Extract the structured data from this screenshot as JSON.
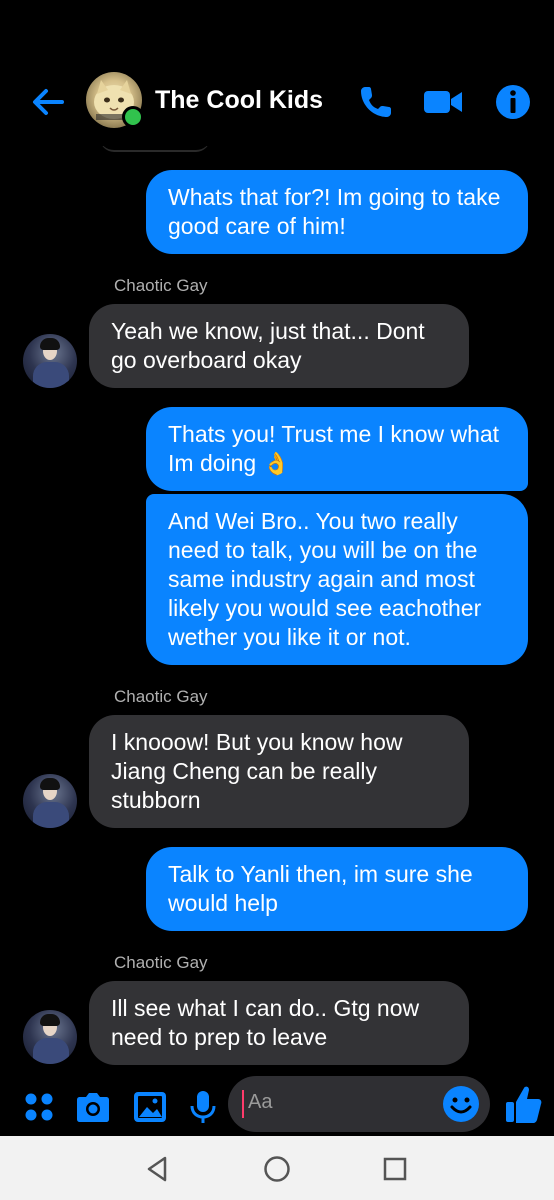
{
  "header": {
    "title": "The Cool Kids",
    "back_icon": "arrow-left-icon",
    "call_icon": "phone-icon",
    "video_icon": "video-camera-icon",
    "info_icon": "info-icon",
    "accent": "#0a84ff",
    "online": true
  },
  "messages": [
    {
      "direction": "out",
      "text": "Whats that for?! Im going to take good care of him!"
    },
    {
      "direction": "in",
      "sender": "Chaotic Gay",
      "text": "Yeah we know, just that... Dont go overboard okay"
    },
    {
      "direction": "out",
      "text": "Thats you! Trust me I know what Im doing",
      "emoji": "👌"
    },
    {
      "direction": "out",
      "text": "And Wei Bro.. You two really need to talk, you will be on the same industry again and most likely you would see eachother wether you like it or not."
    },
    {
      "direction": "in",
      "sender": "Chaotic Gay",
      "text": "I knooow! But you know how Jiang Cheng can be really stubborn"
    },
    {
      "direction": "out",
      "text": "Talk to Yanli  then, im sure she would help"
    },
    {
      "direction": "in",
      "sender": "Chaotic Gay",
      "text": "Ill see what I can do.. Gtg now need to prep to leave"
    }
  ],
  "composer": {
    "placeholder": "Aa",
    "icons": [
      "apps-icon",
      "camera-icon",
      "image-icon",
      "microphone-icon",
      "emoji-icon",
      "thumbs-up-icon"
    ]
  },
  "navbar": {
    "icons": [
      "back-triangle-icon",
      "home-circle-icon",
      "recents-square-icon"
    ]
  },
  "colors": {
    "outgoing_bubble": "#0a84ff",
    "incoming_bubble": "#333336",
    "background": "#000000"
  }
}
